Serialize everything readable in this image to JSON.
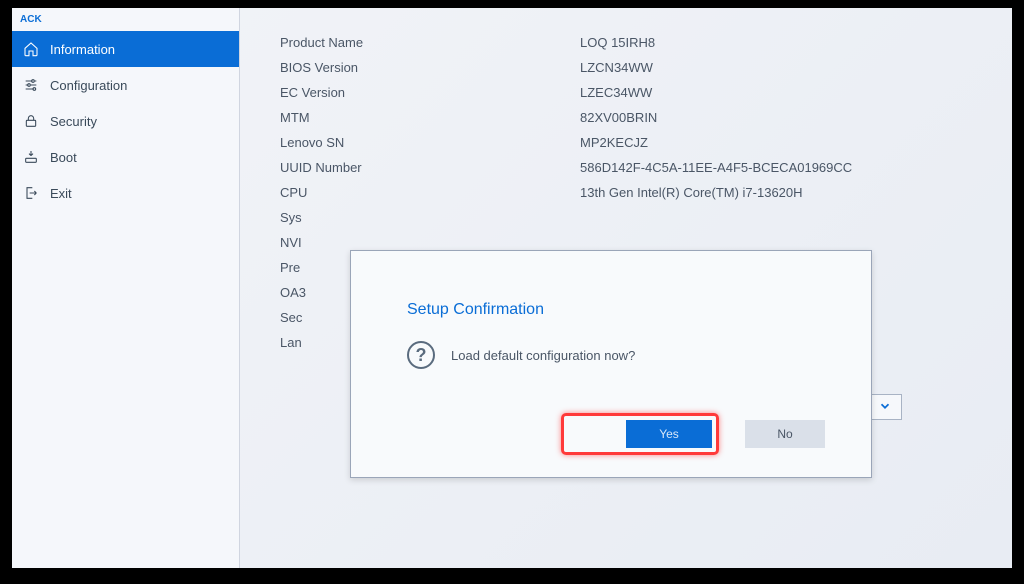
{
  "header": {
    "back": "ACK"
  },
  "sidebar": {
    "items": [
      {
        "label": "Information"
      },
      {
        "label": "Configuration"
      },
      {
        "label": "Security"
      },
      {
        "label": "Boot"
      },
      {
        "label": "Exit"
      }
    ]
  },
  "info": [
    {
      "label": "Product Name",
      "value": "LOQ 15IRH8"
    },
    {
      "label": "BIOS Version",
      "value": "LZCN34WW"
    },
    {
      "label": "EC Version",
      "value": "LZEC34WW"
    },
    {
      "label": "MTM",
      "value": "82XV00BRIN"
    },
    {
      "label": "Lenovo SN",
      "value": "MP2KECJZ"
    },
    {
      "label": "UUID Number",
      "value": "586D142F-4C5A-11EE-A4F5-BCECA01969CC"
    },
    {
      "label": "CPU",
      "value": "13th Gen Intel(R) Core(TM) i7-13620H"
    },
    {
      "label": "Sys",
      "value": ""
    },
    {
      "label": "NVI",
      "value": ""
    },
    {
      "label": "Pre",
      "value": ""
    },
    {
      "label": "OA3",
      "value": ""
    },
    {
      "label": "Sec",
      "value": ""
    },
    {
      "label": "Lan",
      "value": ""
    }
  ],
  "dialog": {
    "title": "Setup Confirmation",
    "message": "Load default configuration now?",
    "yes": "Yes",
    "no": "No"
  }
}
